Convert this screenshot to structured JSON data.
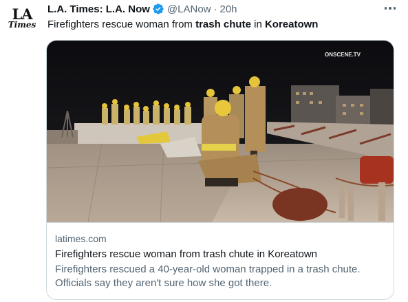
{
  "tweet": {
    "avatar": {
      "line1": "LA",
      "line2": "Times"
    },
    "author_name": "L.A. Times: L.A. Now",
    "handle": "@LANow",
    "separator": "·",
    "time": "20h",
    "verified_icon": "verified-badge-icon",
    "more_icon": "more-options-icon",
    "text": {
      "part1": "Firefighters rescue woman from ",
      "bold1": "trash chute",
      "part2": " in ",
      "bold2": "Koreatown"
    }
  },
  "card": {
    "image_watermark": "ONSCENE.TV",
    "domain": "latimes.com",
    "title": "Firefighters rescue woman from trash chute in Koreatown",
    "description_line1": "Firefighters rescued a 40-year-old woman trapped in a trash chute.",
    "description_line2": "Officials say they aren't sure how she got there."
  },
  "colors": {
    "text_primary": "#0f1419",
    "text_secondary": "#536471",
    "verified": "#1d9bf0",
    "border": "#cfd9de"
  }
}
